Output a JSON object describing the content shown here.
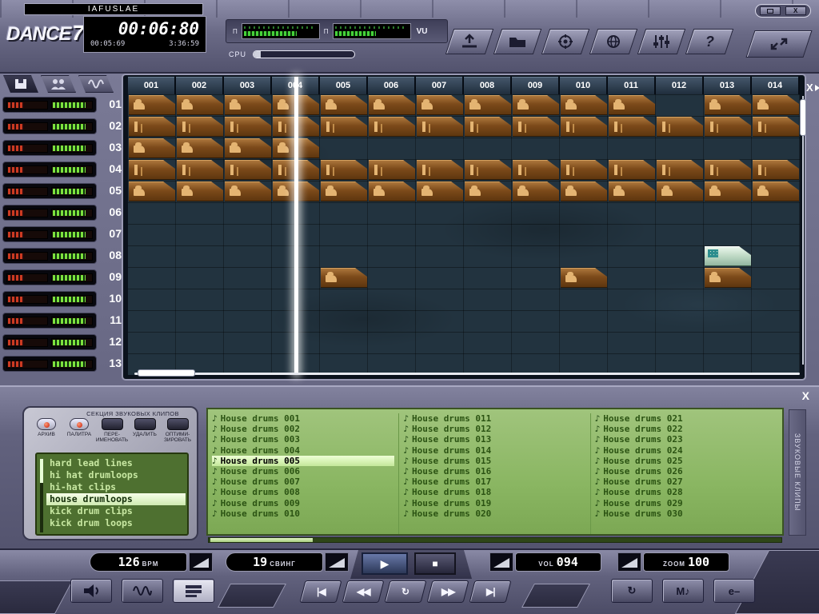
{
  "titlebar": {
    "title": "IAFUSLAE",
    "brand": "DANCE",
    "brand_number": "7",
    "close_label": "X"
  },
  "clock": {
    "time_main": "00:06:80",
    "time_elapsed": "00:05:69",
    "time_total": "3:36:59"
  },
  "meters": {
    "pan_left_label": "Π",
    "pan_right_label": "Π",
    "vu_label": "VU",
    "cpu_label": "CPU",
    "vu_levels": [
      0.7,
      0.55
    ],
    "cpu_level": 0.07
  },
  "toolbar": {
    "help_glyph": "?"
  },
  "sequencer": {
    "columns": [
      "001",
      "002",
      "003",
      "004",
      "005",
      "006",
      "007",
      "008",
      "009",
      "010",
      "011",
      "012",
      "013",
      "014"
    ],
    "close_glyph": "X",
    "playhead_column": 4,
    "meter_red_level": 0.4,
    "meter_green_level": 0.82,
    "tracks": [
      {
        "num": "01",
        "clip_type": "wave",
        "clip_cols": [
          1,
          2,
          3,
          4,
          5,
          6,
          7,
          8,
          9,
          10,
          11,
          13,
          14
        ]
      },
      {
        "num": "02",
        "clip_type": "bar",
        "clip_cols": [
          1,
          2,
          3,
          4,
          5,
          6,
          7,
          8,
          9,
          10,
          11,
          12,
          13,
          14
        ]
      },
      {
        "num": "03",
        "clip_type": "wave",
        "clip_cols": [
          1,
          2,
          3,
          4
        ]
      },
      {
        "num": "04",
        "clip_type": "bar",
        "clip_cols": [
          1,
          2,
          3,
          4,
          5,
          6,
          7,
          8,
          9,
          10,
          11,
          12,
          13,
          14
        ]
      },
      {
        "num": "05",
        "clip_type": "wave",
        "clip_cols": [
          1,
          2,
          3,
          4,
          5,
          6,
          7,
          8,
          9,
          10,
          11,
          12,
          13,
          14
        ]
      },
      {
        "num": "06",
        "clip_type": "wave",
        "clip_cols": []
      },
      {
        "num": "07",
        "clip_type": "wave",
        "clip_cols": []
      },
      {
        "num": "08",
        "clip_type": "green",
        "clip_cols": [
          13
        ]
      },
      {
        "num": "09",
        "clip_type": "wave",
        "clip_cols": [
          5,
          10,
          13
        ]
      },
      {
        "num": "10",
        "clip_type": "wave",
        "clip_cols": []
      },
      {
        "num": "11",
        "clip_type": "wave",
        "clip_cols": []
      },
      {
        "num": "12",
        "clip_type": "wave",
        "clip_cols": []
      },
      {
        "num": "13",
        "clip_type": "wave",
        "clip_cols": []
      }
    ]
  },
  "clip_browser": {
    "section_title": "СЕКЦИЯ ЗВУКОВЫХ КЛИПОВ",
    "tool_buttons": [
      {
        "label": "АРХИВ",
        "kind": "led"
      },
      {
        "label": "ПАЛИТРА",
        "kind": "led"
      },
      {
        "label": "ПЕРЕ- ИМЕНОВАТЬ",
        "kind": "dark"
      },
      {
        "label": "УДАЛИТЬ",
        "kind": "dark"
      },
      {
        "label": "ОПТИМИ- ЗИРОВАТЬ",
        "kind": "dark"
      }
    ],
    "categories": [
      "hard lead lines",
      "hi hat drumloops",
      "hi-hat clips",
      "house drumloops",
      "kick drum clips",
      "kick drum loops"
    ],
    "selected_category": "house drumloops",
    "clip_icon_glyph": "♪",
    "clip_columns": [
      [
        "House drums 001",
        "House drums 002",
        "House drums 003",
        "House drums 004",
        "House drums 005",
        "House drums 006",
        "House drums 007",
        "House drums 008",
        "House drums 009",
        "House drums 010"
      ],
      [
        "House drums 011",
        "House drums 012",
        "House drums 013",
        "House drums 014",
        "House drums 015",
        "House drums 016",
        "House drums 017",
        "House drums 018",
        "House drums 019",
        "House drums 020"
      ],
      [
        "House drums 021",
        "House drums 022",
        "House drums 023",
        "House drums 024",
        "House drums 025",
        "House drums 026",
        "House drums 027",
        "House drums 028",
        "House drums 029",
        "House drums 030"
      ]
    ],
    "selected_clip": "House drums 005",
    "side_label": "ЗВУКОВЫЕ КЛИПЫ",
    "close_label": "X"
  },
  "transport": {
    "bpm_value": "126",
    "bpm_label": "BPM",
    "swing_value": "19",
    "swing_label": "СВИНГ",
    "vol_label": "VOL",
    "vol_value": "094",
    "zoom_label": "ZOOM",
    "zoom_value": "100",
    "play_glyph": "▶",
    "stop_glyph": "■",
    "skip_start_glyph": "|◀",
    "rewind_glyph": "◀◀",
    "loop_glyph": "↻",
    "forward_glyph": "▶▶",
    "skip_end_glyph": "▶|",
    "cycle_glyph": "↻",
    "m_button_label": "M♪",
    "e_button_label": "e–"
  },
  "colors": {
    "chrome": "#6b6b88",
    "grid_bg": "#22333f",
    "clip_brown": "#7c4a1a",
    "clip_green": "#c2dcc8",
    "browser_green": "#8ab662",
    "meter_green": "#7ce23e",
    "meter_red": "#cc3a22",
    "playhead": "#ffffff"
  }
}
